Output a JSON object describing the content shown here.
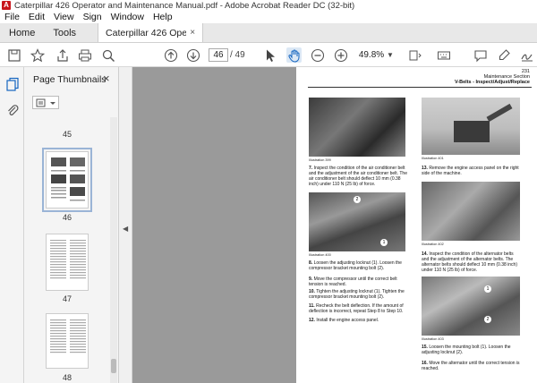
{
  "window": {
    "title": "Caterpillar 426 Operator and Maintenance Manual.pdf - Adobe Acrobat Reader DC (32-bit)"
  },
  "menu": [
    "File",
    "Edit",
    "View",
    "Sign",
    "Window",
    "Help"
  ],
  "tabs": {
    "home": "Home",
    "tools": "Tools",
    "doc": "Caterpillar 426 Ope...",
    "close": "×"
  },
  "toolbar": {
    "page_current": "46",
    "page_total": "/ 49",
    "zoom": "49.8%"
  },
  "thumbnails": {
    "title": "Page Thumbnails",
    "close": "×",
    "pages": [
      {
        "num": "45"
      },
      {
        "num": "46",
        "current": true
      },
      {
        "num": "47"
      },
      {
        "num": "48"
      }
    ]
  },
  "pdf": {
    "page_number": "231",
    "section": "Maintenance Section",
    "subsection": "V-Belts - Inspect/Adjust/Replace",
    "left_col": [
      {
        "label": "7.",
        "text": "Inspect the condition of the air conditioner belt and the adjustment of the air conditioner belt. The air conditioner belt should deflect 10 mm (0.38 inch) under 110 N (25 lb) of force."
      },
      {
        "label": "8.",
        "text": "Loosen the adjusting locknut (1). Loosen the compressor bracket mounting bolt (2)."
      },
      {
        "label": "9.",
        "text": "Move the compressor until the correct belt tension is reached."
      },
      {
        "label": "10.",
        "text": "Tighten the adjusting locknut (1). Tighten the compressor bracket mounting bolt (2)."
      },
      {
        "label": "11.",
        "text": "Recheck the belt deflection. If the amount of deflection is incorrect, repeat Step 8 to Step 10."
      },
      {
        "label": "12.",
        "text": "Install the engine access panel."
      }
    ],
    "right_col": [
      {
        "label": "13.",
        "text": "Remove the engine access panel on the right side of the machine."
      },
      {
        "label": "14.",
        "text": "Inspect the condition of the alternator belts and the adjustment of the alternator belts. The alternator belts should deflect 10 mm (0.38 inch) under 110 N (25 lb) of force."
      },
      {
        "label": "15.",
        "text": "Loosen the mounting bolt (1). Loosen the adjusting locknut (2)."
      },
      {
        "label": "16.",
        "text": "Move the alternator until the correct tension is reached."
      }
    ],
    "illustrations": [
      "Illustration 399",
      "Illustration 400",
      "Illustration 401",
      "Illustration 402",
      "Illustration 403"
    ]
  }
}
